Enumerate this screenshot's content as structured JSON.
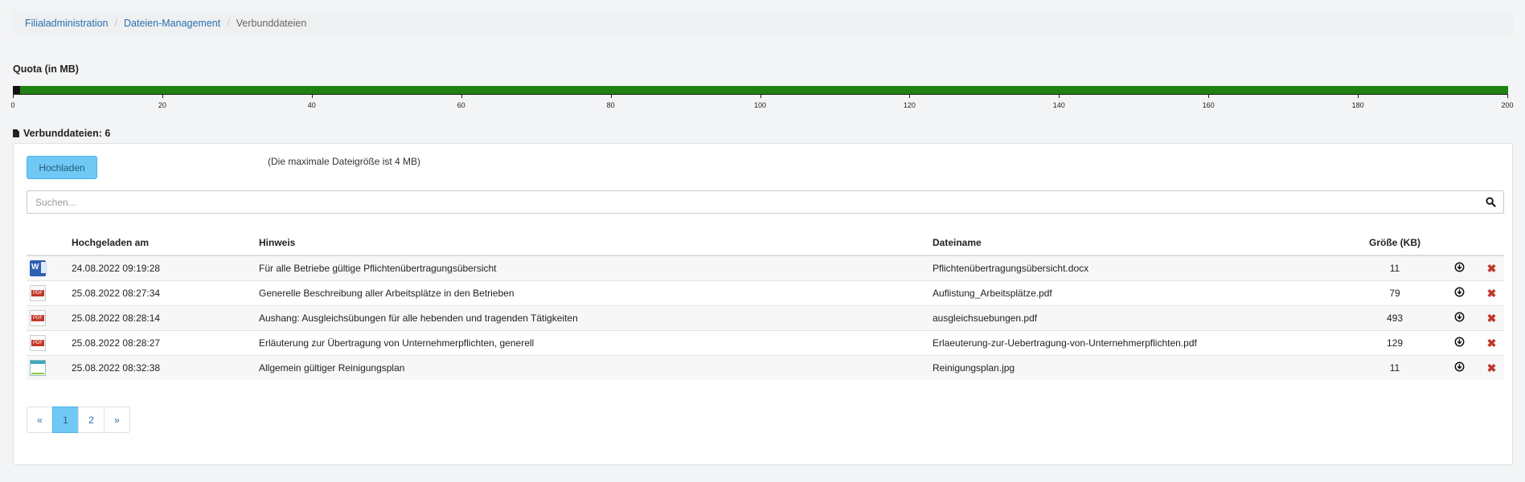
{
  "breadcrumb": {
    "items": [
      "Filialadministration",
      "Dateien-Management"
    ],
    "current": "Verbunddateien",
    "separator": "/"
  },
  "quota": {
    "title": "Quota (in MB)",
    "used_mb": 1,
    "max_mb": 200,
    "ticks": [
      "0",
      "20",
      "40",
      "60",
      "80",
      "100",
      "120",
      "140",
      "160",
      "180",
      "200"
    ],
    "used_color": "#111111",
    "free_color": "#1e8212"
  },
  "files_heading": "Verbunddateien: 6",
  "toolbar": {
    "upload_label": "Hochladen",
    "max_note": "(Die maximale Dateigröße ist 4 MB)"
  },
  "search": {
    "placeholder": "Suchen..."
  },
  "table": {
    "headers": {
      "date": "Hochgeladen am",
      "hint": "Hinweis",
      "filename": "Dateiname",
      "size": "Größe (KB)"
    },
    "rows": [
      {
        "icon": "word-icon",
        "date": "24.08.2022 09:19:28",
        "hint": "Für alle Betriebe gültige Pflichtenübertragungsübersicht",
        "filename": "Pflichtenübertragungsübersicht.docx",
        "size": "11"
      },
      {
        "icon": "pdf-icon",
        "date": "25.08.2022 08:27:34",
        "hint": "Generelle Beschreibung aller Arbeitsplätze in den Betrieben",
        "filename": "Auflistung_Arbeitsplätze.pdf",
        "size": "79"
      },
      {
        "icon": "pdf-icon",
        "date": "25.08.2022 08:28:14",
        "hint": "Aushang: Ausgleichsübungen für alle hebenden und tragenden Tätigkeiten",
        "filename": "ausgleichsuebungen.pdf",
        "size": "493"
      },
      {
        "icon": "pdf-icon",
        "date": "25.08.2022 08:28:27",
        "hint": "Erläuterung zur Übertragung von Unternehmerpflichten, generell",
        "filename": "Erlaeuterung-zur-Uebertragung-von-Unternehmerpflichten.pdf",
        "size": "129"
      },
      {
        "icon": "image-icon",
        "date": "25.08.2022 08:32:38",
        "hint": "Allgemein gültiger Reinigungsplan",
        "filename": "Reinigungsplan.jpg",
        "size": "11"
      }
    ],
    "row_action_icons": [
      "download-icon",
      "delete-icon"
    ]
  },
  "pagination": {
    "prev": "«",
    "pages": [
      "1",
      "2"
    ],
    "active": "1",
    "next": "»"
  }
}
